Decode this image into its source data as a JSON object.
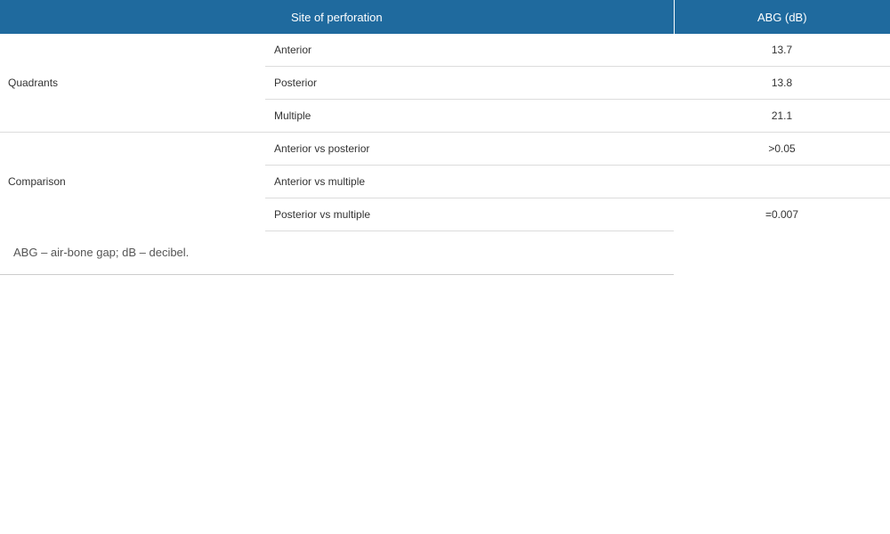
{
  "table": {
    "headers": [
      "Site of perforation",
      "ABG (dB)"
    ],
    "groups": [
      {
        "label": "Quadrants",
        "rows": [
          {
            "label": "Anterior",
            "value": "13.7"
          },
          {
            "label": "Posterior",
            "value": "13.8"
          },
          {
            "label": "Multiple",
            "value": "21.1"
          }
        ]
      },
      {
        "label": "Comparison",
        "rows": [
          {
            "label": "Anterior vs posterior",
            "value": ">0.05"
          },
          {
            "label": "Anterior vs multiple",
            "value": ""
          },
          {
            "label": "Posterior vs multiple",
            "value": "=0.007"
          }
        ]
      }
    ]
  },
  "footnote": "ABG – air-bone gap; dB – decibel.",
  "colors": {
    "header_bg": "#1f6a9e",
    "header_text": "#ffffff"
  }
}
